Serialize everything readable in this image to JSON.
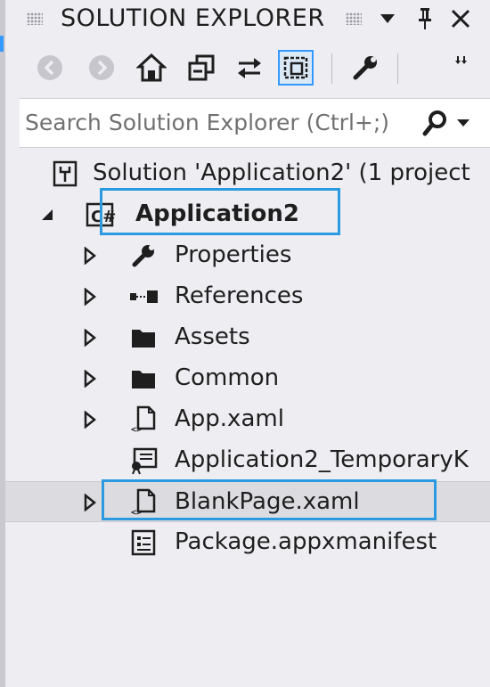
{
  "panel": {
    "title": "SOLUTION EXPLORER",
    "accent_color": "#3399ff",
    "highlight_color": "#2b9ae0"
  },
  "toolbar": {
    "buttons": [
      {
        "name": "back-icon"
      },
      {
        "name": "forward-icon"
      },
      {
        "name": "home-icon"
      },
      {
        "name": "collapse-all-icon"
      },
      {
        "name": "sync-icon"
      },
      {
        "name": "show-all-files-icon",
        "active": true
      },
      {
        "name": "properties-wrench-icon"
      }
    ]
  },
  "search": {
    "placeholder": "Search Solution Explorer (Ctrl+;)"
  },
  "tree": {
    "solution": "Solution 'Application2' (1 project",
    "project": "Application2",
    "items": [
      {
        "label": "Properties",
        "icon": "wrench-icon"
      },
      {
        "label": "References",
        "icon": "references-icon"
      },
      {
        "label": "Assets",
        "icon": "folder-icon"
      },
      {
        "label": "Common",
        "icon": "folder-icon"
      },
      {
        "label": "App.xaml",
        "icon": "xaml-file-icon"
      },
      {
        "label": "Application2_TemporaryK",
        "icon": "certificate-icon"
      },
      {
        "label": "BlankPage.xaml",
        "icon": "xaml-file-icon",
        "selected": true
      },
      {
        "label": "Package.appxmanifest",
        "icon": "manifest-icon"
      }
    ]
  }
}
